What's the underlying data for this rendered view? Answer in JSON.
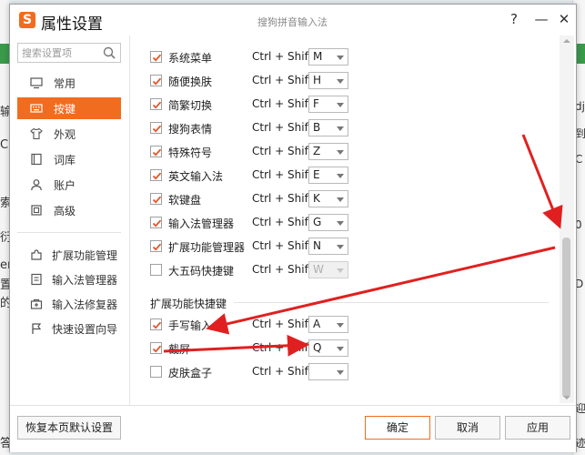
{
  "window": {
    "title": "属性设置",
    "app_name": "搜狗拼音输入法",
    "logo_letter": "S",
    "help_label": "?",
    "min_label": "—",
    "close_label": "✕",
    "accent": "#f26c1f"
  },
  "sidebar": {
    "search_placeholder": "搜索设置项",
    "items": [
      {
        "label": "常用",
        "icon": "monitor-icon"
      },
      {
        "label": "按键",
        "icon": "keyboard-icon",
        "active": true
      },
      {
        "label": "外观",
        "icon": "shirt-icon"
      },
      {
        "label": "词库",
        "icon": "book-icon"
      },
      {
        "label": "账户",
        "icon": "user-icon"
      },
      {
        "label": "高级",
        "icon": "advanced-icon"
      }
    ],
    "tools": [
      {
        "label": "扩展功能管理",
        "icon": "puzzle-icon"
      },
      {
        "label": "输入法管理器",
        "icon": "list-icon"
      },
      {
        "label": "输入法修复器",
        "icon": "repair-icon"
      },
      {
        "label": "快速设置向导",
        "icon": "flag-icon"
      }
    ]
  },
  "shortcuts": [
    {
      "label": "系统菜单",
      "combo": "Ctrl + Shift +",
      "key": "M",
      "checked": true
    },
    {
      "label": "随便换肤",
      "combo": "Ctrl + Shift +",
      "key": "H",
      "checked": true
    },
    {
      "label": "简繁切换",
      "combo": "Ctrl + Shift +",
      "key": "F",
      "checked": true
    },
    {
      "label": "搜狗表情",
      "combo": "Ctrl + Shift +",
      "key": "B",
      "checked": true
    },
    {
      "label": "特殊符号",
      "combo": "Ctrl + Shift +",
      "key": "Z",
      "checked": true
    },
    {
      "label": "英文输入法",
      "combo": "Ctrl + Shift +",
      "key": "E",
      "checked": true
    },
    {
      "label": "软键盘",
      "combo": "Ctrl + Shift +",
      "key": "K",
      "checked": true
    },
    {
      "label": "输入法管理器",
      "combo": "Ctrl + Shift +",
      "key": "G",
      "checked": true
    },
    {
      "label": "扩展功能管理器",
      "combo": "Ctrl + Shift +",
      "key": "N",
      "checked": true
    },
    {
      "label": "大五码快捷键",
      "combo": "Ctrl + Shift +",
      "key": "W",
      "checked": false,
      "disabled": true
    }
  ],
  "extension_section": {
    "title": "扩展功能快捷键",
    "items": [
      {
        "label": "手写输入",
        "combo": "Ctrl + Shift +",
        "key": "A",
        "checked": true
      },
      {
        "label": "截屏",
        "combo": "Ctrl + Shift +",
        "key": "Q",
        "checked": true
      },
      {
        "label": "皮肤盒子",
        "combo": "Ctrl + Shift +",
        "key": "",
        "checked": false
      }
    ]
  },
  "footer": {
    "restore_label": "恢复本页默认设置",
    "ok_label": "确定",
    "cancel_label": "取消",
    "apply_label": "应用"
  },
  "background": {
    "left_chars": [
      "输",
      "C",
      "索",
      "衍",
      "en",
      "置",
      "的",
      "答"
    ],
    "right_chars": [
      "dj",
      "到",
      "C",
      "0",
      "D",
      "迎",
      "迹"
    ]
  },
  "annotation_color": "#e02020"
}
